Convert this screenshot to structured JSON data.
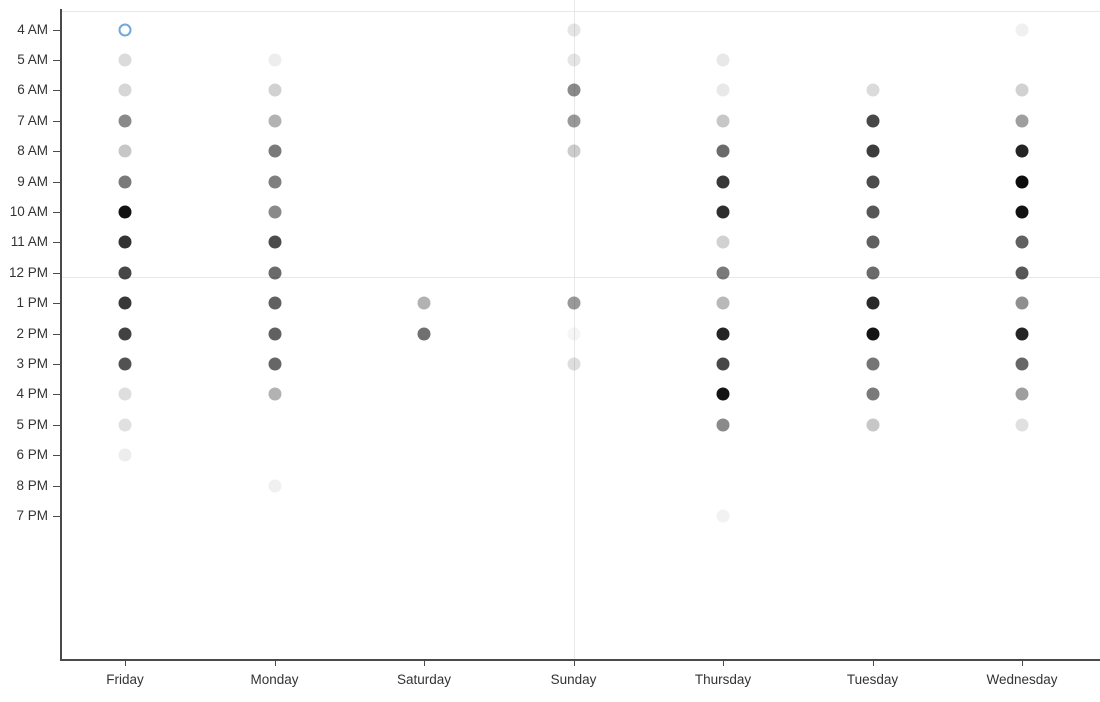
{
  "chart_data": {
    "type": "scatter",
    "title": "",
    "xlabel": "",
    "ylabel": "",
    "grid": true,
    "legend": "none",
    "x_categories": [
      "Friday",
      "Monday",
      "Saturday",
      "Sunday",
      "Thursday",
      "Tuesday",
      "Wednesday"
    ],
    "y_categories": [
      "4 AM",
      "5 AM",
      "6 AM",
      "7 AM",
      "8 AM",
      "9 AM",
      "10 AM",
      "11 AM",
      "12 PM",
      "1 PM",
      "2 PM",
      "3 PM",
      "4 PM",
      "5 PM",
      "6 PM",
      "8 PM",
      "7 PM"
    ],
    "encoding": "dot opacity encodes magnitude (darker = higher value)",
    "points": [
      {
        "x": "Friday",
        "y": "4 AM",
        "opacity": 0.0,
        "state": "selected"
      },
      {
        "x": "Friday",
        "y": "5 AM",
        "opacity": 0.14
      },
      {
        "x": "Friday",
        "y": "6 AM",
        "opacity": 0.16
      },
      {
        "x": "Friday",
        "y": "7 AM",
        "opacity": 0.46
      },
      {
        "x": "Friday",
        "y": "8 AM",
        "opacity": 0.22
      },
      {
        "x": "Friday",
        "y": "9 AM",
        "opacity": 0.52
      },
      {
        "x": "Friday",
        "y": "10 AM",
        "opacity": 0.93
      },
      {
        "x": "Friday",
        "y": "11 AM",
        "opacity": 0.8
      },
      {
        "x": "Friday",
        "y": "12 PM",
        "opacity": 0.72
      },
      {
        "x": "Friday",
        "y": "1 PM",
        "opacity": 0.78
      },
      {
        "x": "Friday",
        "y": "2 PM",
        "opacity": 0.74
      },
      {
        "x": "Friday",
        "y": "3 PM",
        "opacity": 0.68
      },
      {
        "x": "Friday",
        "y": "4 PM",
        "opacity": 0.13
      },
      {
        "x": "Friday",
        "y": "5 PM",
        "opacity": 0.12
      },
      {
        "x": "Friday",
        "y": "6 PM",
        "opacity": 0.07
      },
      {
        "x": "Monday",
        "y": "5 AM",
        "opacity": 0.07
      },
      {
        "x": "Monday",
        "y": "6 AM",
        "opacity": 0.18
      },
      {
        "x": "Monday",
        "y": "7 AM",
        "opacity": 0.3
      },
      {
        "x": "Monday",
        "y": "8 AM",
        "opacity": 0.52
      },
      {
        "x": "Monday",
        "y": "9 AM",
        "opacity": 0.5
      },
      {
        "x": "Monday",
        "y": "10 AM",
        "opacity": 0.46
      },
      {
        "x": "Monday",
        "y": "11 AM",
        "opacity": 0.7
      },
      {
        "x": "Monday",
        "y": "12 PM",
        "opacity": 0.58
      },
      {
        "x": "Monday",
        "y": "1 PM",
        "opacity": 0.62
      },
      {
        "x": "Monday",
        "y": "2 PM",
        "opacity": 0.62
      },
      {
        "x": "Monday",
        "y": "3 PM",
        "opacity": 0.6
      },
      {
        "x": "Monday",
        "y": "4 PM",
        "opacity": 0.3
      },
      {
        "x": "Monday",
        "y": "8 PM",
        "opacity": 0.06
      },
      {
        "x": "Saturday",
        "y": "1 PM",
        "opacity": 0.3
      },
      {
        "x": "Saturday",
        "y": "2 PM",
        "opacity": 0.56
      },
      {
        "x": "Sunday",
        "y": "4 AM",
        "opacity": 0.1
      },
      {
        "x": "Sunday",
        "y": "5 AM",
        "opacity": 0.1
      },
      {
        "x": "Sunday",
        "y": "6 AM",
        "opacity": 0.46
      },
      {
        "x": "Sunday",
        "y": "7 AM",
        "opacity": 0.4
      },
      {
        "x": "Sunday",
        "y": "8 AM",
        "opacity": 0.2
      },
      {
        "x": "Sunday",
        "y": "1 PM",
        "opacity": 0.4
      },
      {
        "x": "Sunday",
        "y": "2 PM",
        "opacity": 0.04
      },
      {
        "x": "Sunday",
        "y": "3 PM",
        "opacity": 0.13
      },
      {
        "x": "Thursday",
        "y": "5 AM",
        "opacity": 0.09
      },
      {
        "x": "Thursday",
        "y": "6 AM",
        "opacity": 0.09
      },
      {
        "x": "Thursday",
        "y": "7 AM",
        "opacity": 0.22
      },
      {
        "x": "Thursday",
        "y": "8 AM",
        "opacity": 0.58
      },
      {
        "x": "Thursday",
        "y": "9 AM",
        "opacity": 0.78
      },
      {
        "x": "Thursday",
        "y": "10 AM",
        "opacity": 0.82
      },
      {
        "x": "Thursday",
        "y": "11 AM",
        "opacity": 0.18
      },
      {
        "x": "Thursday",
        "y": "12 PM",
        "opacity": 0.52
      },
      {
        "x": "Thursday",
        "y": "1 PM",
        "opacity": 0.28
      },
      {
        "x": "Thursday",
        "y": "2 PM",
        "opacity": 0.86
      },
      {
        "x": "Thursday",
        "y": "3 PM",
        "opacity": 0.72
      },
      {
        "x": "Thursday",
        "y": "4 PM",
        "opacity": 0.92
      },
      {
        "x": "Thursday",
        "y": "5 PM",
        "opacity": 0.46
      },
      {
        "x": "Thursday",
        "y": "7 PM",
        "opacity": 0.05
      },
      {
        "x": "Tuesday",
        "y": "6 AM",
        "opacity": 0.14
      },
      {
        "x": "Tuesday",
        "y": "7 AM",
        "opacity": 0.72
      },
      {
        "x": "Tuesday",
        "y": "8 AM",
        "opacity": 0.76
      },
      {
        "x": "Tuesday",
        "y": "9 AM",
        "opacity": 0.7
      },
      {
        "x": "Tuesday",
        "y": "10 AM",
        "opacity": 0.66
      },
      {
        "x": "Tuesday",
        "y": "11 AM",
        "opacity": 0.62
      },
      {
        "x": "Tuesday",
        "y": "12 PM",
        "opacity": 0.58
      },
      {
        "x": "Tuesday",
        "y": "1 PM",
        "opacity": 0.84
      },
      {
        "x": "Tuesday",
        "y": "2 PM",
        "opacity": 0.92
      },
      {
        "x": "Tuesday",
        "y": "3 PM",
        "opacity": 0.54
      },
      {
        "x": "Tuesday",
        "y": "4 PM",
        "opacity": 0.52
      },
      {
        "x": "Tuesday",
        "y": "5 PM",
        "opacity": 0.22
      },
      {
        "x": "Wednesday",
        "y": "4 AM",
        "opacity": 0.06
      },
      {
        "x": "Wednesday",
        "y": "6 AM",
        "opacity": 0.18
      },
      {
        "x": "Wednesday",
        "y": "7 AM",
        "opacity": 0.38
      },
      {
        "x": "Wednesday",
        "y": "8 AM",
        "opacity": 0.86
      },
      {
        "x": "Wednesday",
        "y": "9 AM",
        "opacity": 0.95
      },
      {
        "x": "Wednesday",
        "y": "10 AM",
        "opacity": 0.93
      },
      {
        "x": "Wednesday",
        "y": "11 AM",
        "opacity": 0.62
      },
      {
        "x": "Wednesday",
        "y": "12 PM",
        "opacity": 0.66
      },
      {
        "x": "Wednesday",
        "y": "1 PM",
        "opacity": 0.44
      },
      {
        "x": "Wednesday",
        "y": "2 PM",
        "opacity": 0.86
      },
      {
        "x": "Wednesday",
        "y": "3 PM",
        "opacity": 0.6
      },
      {
        "x": "Wednesday",
        "y": "4 PM",
        "opacity": 0.38
      },
      {
        "x": "Wednesday",
        "y": "5 PM",
        "opacity": 0.12
      }
    ],
    "gridlines": {
      "horizontal_at": [
        "top",
        "12 PM"
      ],
      "vertical_at": [
        "Sunday"
      ]
    },
    "colors": {
      "dot": "#000000",
      "selected_dot_border": "#6fa8dc",
      "axis": "#4a4a4a",
      "gridline": "#e8e8e8",
      "tick_label": "#333333",
      "background": "#ffffff"
    }
  }
}
